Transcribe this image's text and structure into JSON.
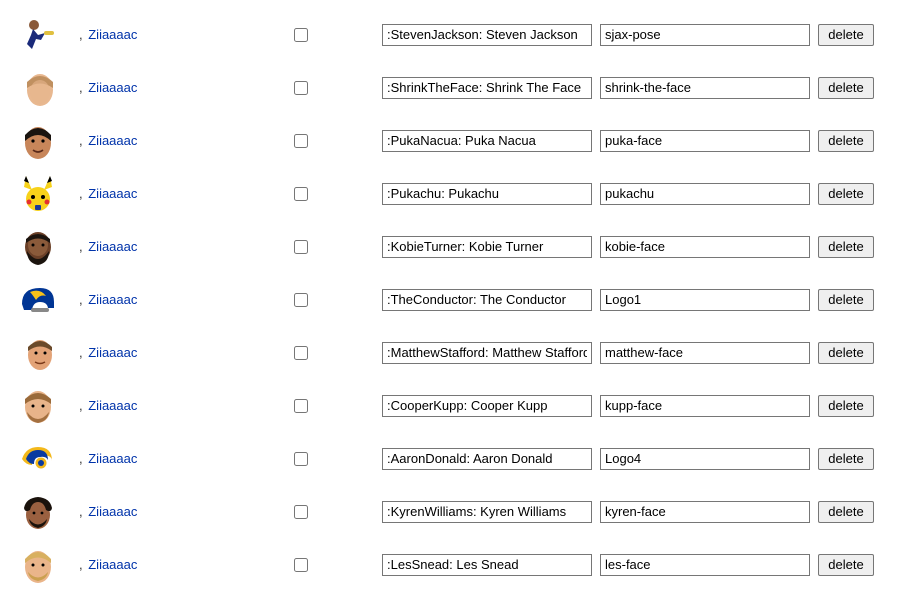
{
  "username": "Ziiaaaac",
  "delete_label": "delete",
  "rows": [
    {
      "desc": ":StevenJackson: Steven Jackson",
      "code": "sjax-pose",
      "avatar": "football-player-run"
    },
    {
      "desc": ":ShrinkTheFace: Shrink The Face",
      "code": "shrink-the-face",
      "avatar": "blurred-face"
    },
    {
      "desc": ":PukaNacua: Puka Nacua",
      "code": "puka-face",
      "avatar": "dark-hair-face"
    },
    {
      "desc": ":Pukachu: Pukachu",
      "code": "pukachu",
      "avatar": "pikachu"
    },
    {
      "desc": ":KobieTurner: Kobie Turner",
      "code": "kobie-face",
      "avatar": "beard-face"
    },
    {
      "desc": ":TheConductor: The Conductor",
      "code": "Logo1",
      "avatar": "rams-helmet"
    },
    {
      "desc": ":MatthewStafford: Matthew Stafford",
      "code": "matthew-face",
      "avatar": "short-hair-face-r"
    },
    {
      "desc": ":CooperKupp: Cooper Kupp",
      "code": "kupp-face",
      "avatar": "light-beard-face"
    },
    {
      "desc": ":AaronDonald: Aaron Donald",
      "code": "Logo4",
      "avatar": "rams-logo-horns"
    },
    {
      "desc": ":KyrenWilliams: Kyren Williams",
      "code": "kyren-face",
      "avatar": "curly-hair-face"
    },
    {
      "desc": ":LesSnead: Les Snead",
      "code": "les-face",
      "avatar": "blonde-face"
    }
  ]
}
